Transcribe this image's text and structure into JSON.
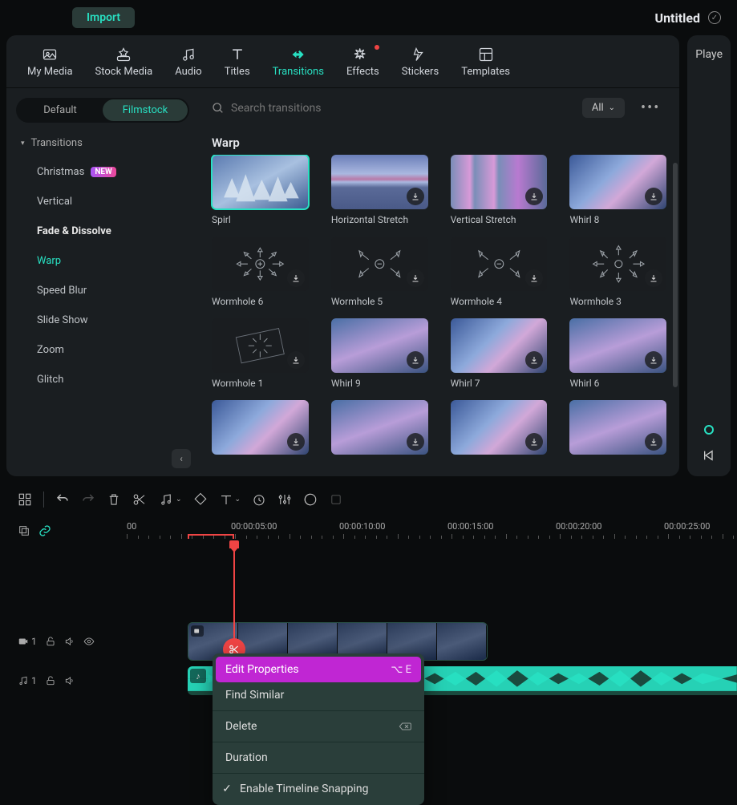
{
  "titlebar": {
    "import": "Import",
    "project_title": "Untitled"
  },
  "top_tabs": [
    {
      "id": "my-media",
      "label": "My Media"
    },
    {
      "id": "stock-media",
      "label": "Stock Media"
    },
    {
      "id": "audio",
      "label": "Audio"
    },
    {
      "id": "titles",
      "label": "Titles"
    },
    {
      "id": "transitions",
      "label": "Transitions",
      "active": true
    },
    {
      "id": "effects",
      "label": "Effects",
      "dot": true
    },
    {
      "id": "stickers",
      "label": "Stickers"
    },
    {
      "id": "templates",
      "label": "Templates"
    }
  ],
  "library_tabs": {
    "default": "Default",
    "filmstock": "Filmstock",
    "active": "filmstock"
  },
  "sidebar_header": "Transitions",
  "categories": [
    {
      "label": "Christmas",
      "badge": "NEW"
    },
    {
      "label": "Vertical"
    },
    {
      "label": "Fade & Dissolve",
      "bold": true
    },
    {
      "label": "Warp",
      "active": true
    },
    {
      "label": "Speed Blur"
    },
    {
      "label": "Slide Show"
    },
    {
      "label": "Zoom"
    },
    {
      "label": "Glitch"
    }
  ],
  "search": {
    "placeholder": "Search transitions"
  },
  "filter": {
    "label": "All"
  },
  "grid_section_title": "Warp",
  "grid_items": [
    {
      "label": "Spirl",
      "selected": true,
      "style": "ice-crystals"
    },
    {
      "label": "Horizontal Stretch",
      "dl": true,
      "style": "stripes-h"
    },
    {
      "label": "Vertical Stretch",
      "dl": true,
      "style": "stripes-v"
    },
    {
      "label": "Whirl 8",
      "dl": true,
      "style": "sky-grad"
    },
    {
      "label": "Wormhole 6",
      "dl": true,
      "style": "dark-arrows",
      "arrows": "in"
    },
    {
      "label": "Wormhole 5",
      "dl": true,
      "style": "dark-arrows",
      "arrows": "rand"
    },
    {
      "label": "Wormhole 4",
      "dl": true,
      "style": "dark-arrows",
      "arrows": "rand2"
    },
    {
      "label": "Wormhole 3",
      "dl": true,
      "style": "dark-arrows",
      "arrows": "out"
    },
    {
      "label": "Wormhole 1",
      "dl": true,
      "style": "wormhole1"
    },
    {
      "label": "Whirl 9",
      "dl": true,
      "style": "sky-grad2"
    },
    {
      "label": "Whirl 7",
      "dl": true,
      "style": "sky-grad"
    },
    {
      "label": "Whirl 6",
      "dl": true,
      "style": "sky-grad2"
    },
    {
      "label": "",
      "dl": true,
      "style": "sky-grad"
    },
    {
      "label": "",
      "dl": true,
      "style": "sky-grad2"
    },
    {
      "label": "",
      "dl": true,
      "style": "sky-grad"
    },
    {
      "label": "",
      "dl": true,
      "style": "sky-grad2"
    }
  ],
  "player": {
    "label": "Playe"
  },
  "timeline": {
    "ruler": [
      "00",
      "00:00:05:00",
      "00:00:10:00",
      "00:00:15:00",
      "00:00:20:00",
      "00:00:25:00"
    ],
    "video_track_num": "1",
    "audio_track_num": "1"
  },
  "context_menu": {
    "items": [
      {
        "label": "Edit Properties",
        "shortcut": "⌥ E",
        "highlighted": true
      },
      {
        "label": "Find Similar"
      },
      {
        "sep": true
      },
      {
        "label": "Delete",
        "del_icon": true
      },
      {
        "sep": true
      },
      {
        "label": "Duration"
      },
      {
        "sep": true
      },
      {
        "label": "Enable Timeline Snapping",
        "check": true
      }
    ]
  }
}
